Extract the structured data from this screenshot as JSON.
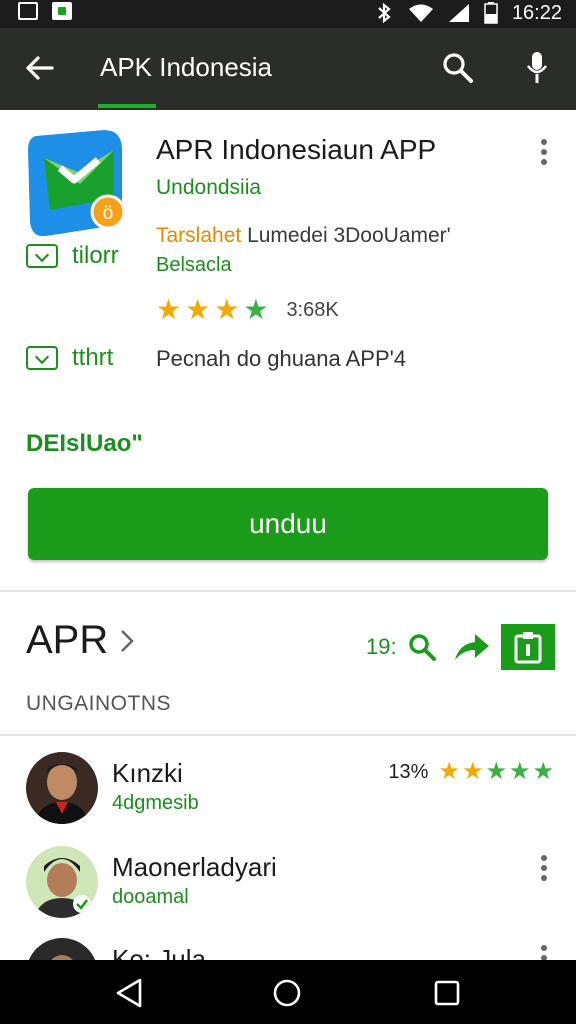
{
  "status_bar": {
    "time": "16:22"
  },
  "app_bar": {
    "title": "APK Indonesia"
  },
  "app": {
    "name": "APR Indonesiaun APP",
    "developer": "Undondsiia",
    "tag_orange": "Tarslahet",
    "tag_text": "Lumedei 3DooUamer'",
    "category": "Belsacla",
    "badge1": "tilorr",
    "badge2": "tthrt",
    "rating_count": "3:68K",
    "description": "Pecnah do ghuana APP'4",
    "detail_label": "DEIslUao\"",
    "install_label": "unduu"
  },
  "section": {
    "title": "APR",
    "count": "19:",
    "subtitle": "UNGAINOTNS"
  },
  "reviews": [
    {
      "name": "Kınzki",
      "sub": "4dgmesib",
      "rating_text": "13%"
    },
    {
      "name": "Maonerladyari",
      "sub": "dooamal"
    },
    {
      "name": "Ko: Jula"
    }
  ],
  "colors": {
    "accent_green": "#1a9c1a",
    "star_gold": "#f2a900",
    "app_bar": "#2b2d2b"
  }
}
